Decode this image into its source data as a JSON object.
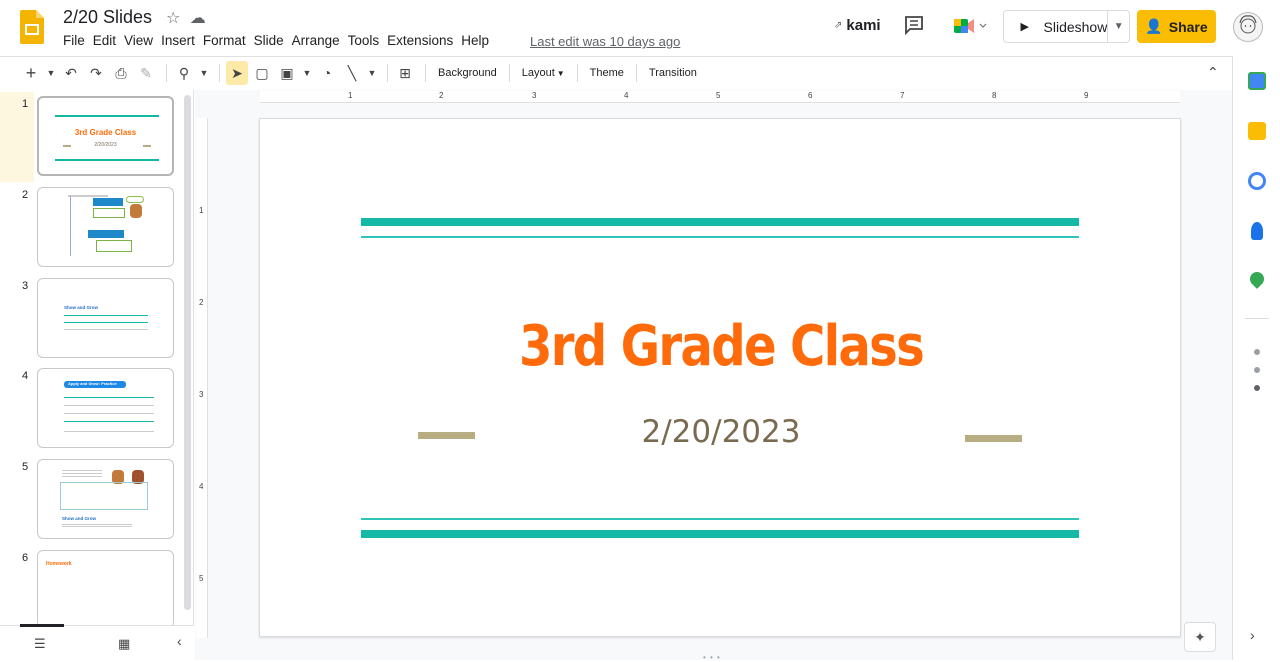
{
  "header": {
    "doc_title": "2/20 Slides",
    "menu": [
      "File",
      "Edit",
      "View",
      "Insert",
      "Format",
      "Slide",
      "Arrange",
      "Tools",
      "Extensions",
      "Help"
    ],
    "last_edit": "Last edit was 10 days ago",
    "kami_label": "kami",
    "slideshow_label": "Slideshow",
    "share_label": "Share"
  },
  "toolbar": {
    "background_label": "Background",
    "layout_label": "Layout",
    "theme_label": "Theme",
    "transition_label": "Transition"
  },
  "ruler": {
    "top_marks": [
      "1",
      "2",
      "3",
      "4",
      "5",
      "6",
      "7",
      "8",
      "9"
    ],
    "left_marks": [
      "1",
      "2",
      "3",
      "4",
      "5"
    ]
  },
  "filmstrip": {
    "slides": [
      {
        "num": "1",
        "title": "3rd Grade Class",
        "subtitle": "2/20/2023"
      },
      {
        "num": "2"
      },
      {
        "num": "3",
        "title": "Show and Grow"
      },
      {
        "num": "4",
        "title": "Apply and Grow: Practice"
      },
      {
        "num": "5",
        "title": "Show and Grow"
      },
      {
        "num": "6",
        "title": "Homework"
      }
    ]
  },
  "slide": {
    "title": "3rd Grade Class",
    "date": "2/20/2023"
  },
  "colors": {
    "title_orange": "#ff6b0a",
    "teal": "#14b8a6",
    "tan": "#b8ad82",
    "share_yellow": "#fbbc04",
    "selected_slide_bg": "#fef7e0"
  }
}
